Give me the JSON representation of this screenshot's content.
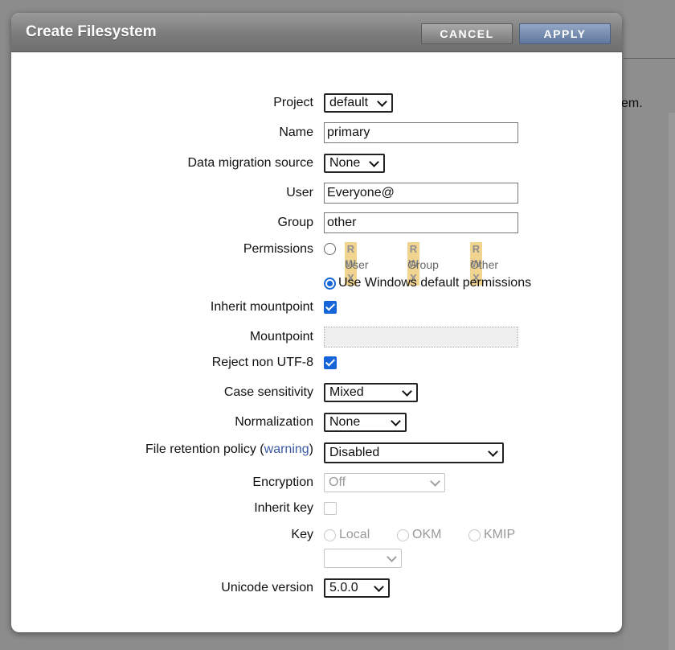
{
  "background": {
    "partial_text": "em."
  },
  "dialog": {
    "title": "Create Filesystem",
    "cancel_label": "CANCEL",
    "apply_label": "APPLY"
  },
  "form": {
    "project": {
      "label": "Project",
      "value": "default"
    },
    "name": {
      "label": "Name",
      "value": "primary"
    },
    "data_migration_source": {
      "label": "Data migration source",
      "value": "None"
    },
    "user": {
      "label": "User",
      "value": "Everyone@"
    },
    "group": {
      "label": "Group",
      "value": "other"
    },
    "permissions": {
      "label": "Permissions",
      "bits": [
        "R",
        "W",
        "X"
      ],
      "groups": [
        "User",
        "Group",
        "Other"
      ],
      "windows_default_label": "Use Windows default permissions",
      "windows_default_selected": true
    },
    "inherit_mountpoint": {
      "label": "Inherit mountpoint",
      "checked": true
    },
    "mountpoint": {
      "label": "Mountpoint",
      "value": ""
    },
    "reject_non_utf8": {
      "label": "Reject non UTF-8",
      "checked": true
    },
    "case_sensitivity": {
      "label": "Case sensitivity",
      "value": "Mixed"
    },
    "normalization": {
      "label": "Normalization",
      "value": "None"
    },
    "file_retention_policy": {
      "label": "File retention policy",
      "warning_link": "warning",
      "value": "Disabled"
    },
    "encryption": {
      "label": "Encryption",
      "value": "Off",
      "disabled": true
    },
    "inherit_key": {
      "label": "Inherit key",
      "checked": false,
      "disabled": true
    },
    "key": {
      "label": "Key",
      "options": [
        "Local",
        "OKM",
        "KMIP"
      ],
      "select_value": ""
    },
    "unicode_version": {
      "label": "Unicode version",
      "value": "5.0.0"
    }
  },
  "colors": {
    "accent": "#1565d8",
    "perm_bit_bg": "#f0d48f",
    "link": "#3b5aa3",
    "titlebar": "#7c7c7c"
  }
}
